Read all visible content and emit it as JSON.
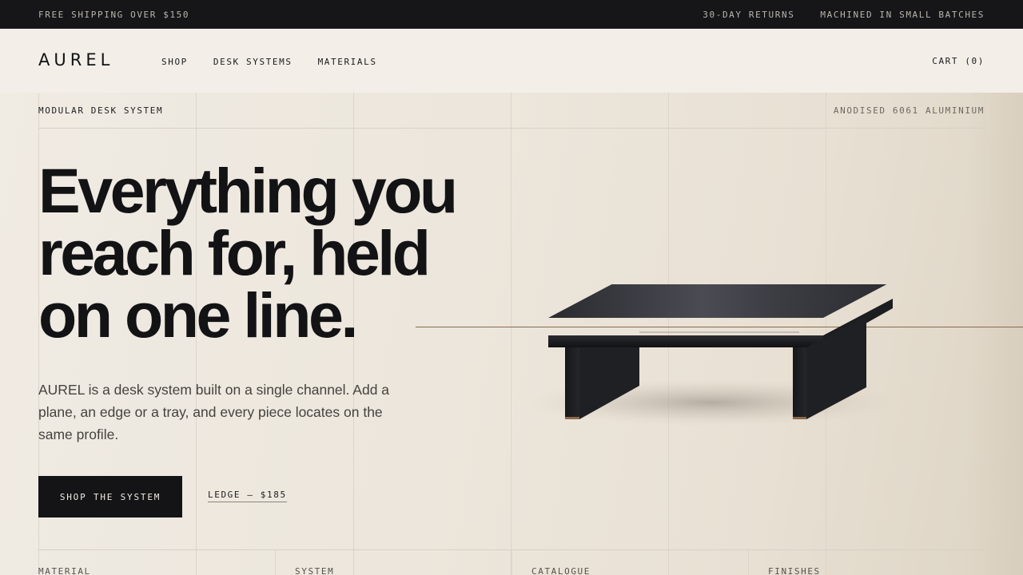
{
  "announcement": {
    "left": "FREE SHIPPING OVER $150",
    "right": [
      "30-DAY RETURNS",
      "MACHINED IN SMALL BATCHES"
    ]
  },
  "header": {
    "logo": "AUREL",
    "nav": [
      "SHOP",
      "DESK SYSTEMS",
      "MATERIALS"
    ],
    "cart": "CART (0)"
  },
  "hero": {
    "eyebrow_left": "MODULAR DESK SYSTEM",
    "eyebrow_right": "ANODISED 6061 ALUMINIUM",
    "headline": [
      "Everything you",
      "reach for, held",
      "on one line."
    ],
    "description": "AUREL is a desk system built on a single channel. Add a plane, an edge or a tray, and every piece locates on the same profile.",
    "cta_label": "SHOP THE SYSTEM",
    "secondary_link": "LEDGE — $185"
  },
  "footer_columns": [
    "MATERIAL",
    "SYSTEM",
    "CATALOGUE",
    "FINISHES"
  ],
  "colors": {
    "background": "#f1ece4",
    "topbar": "#161618",
    "ink": "#141416",
    "accent": "#8b6a4a"
  }
}
